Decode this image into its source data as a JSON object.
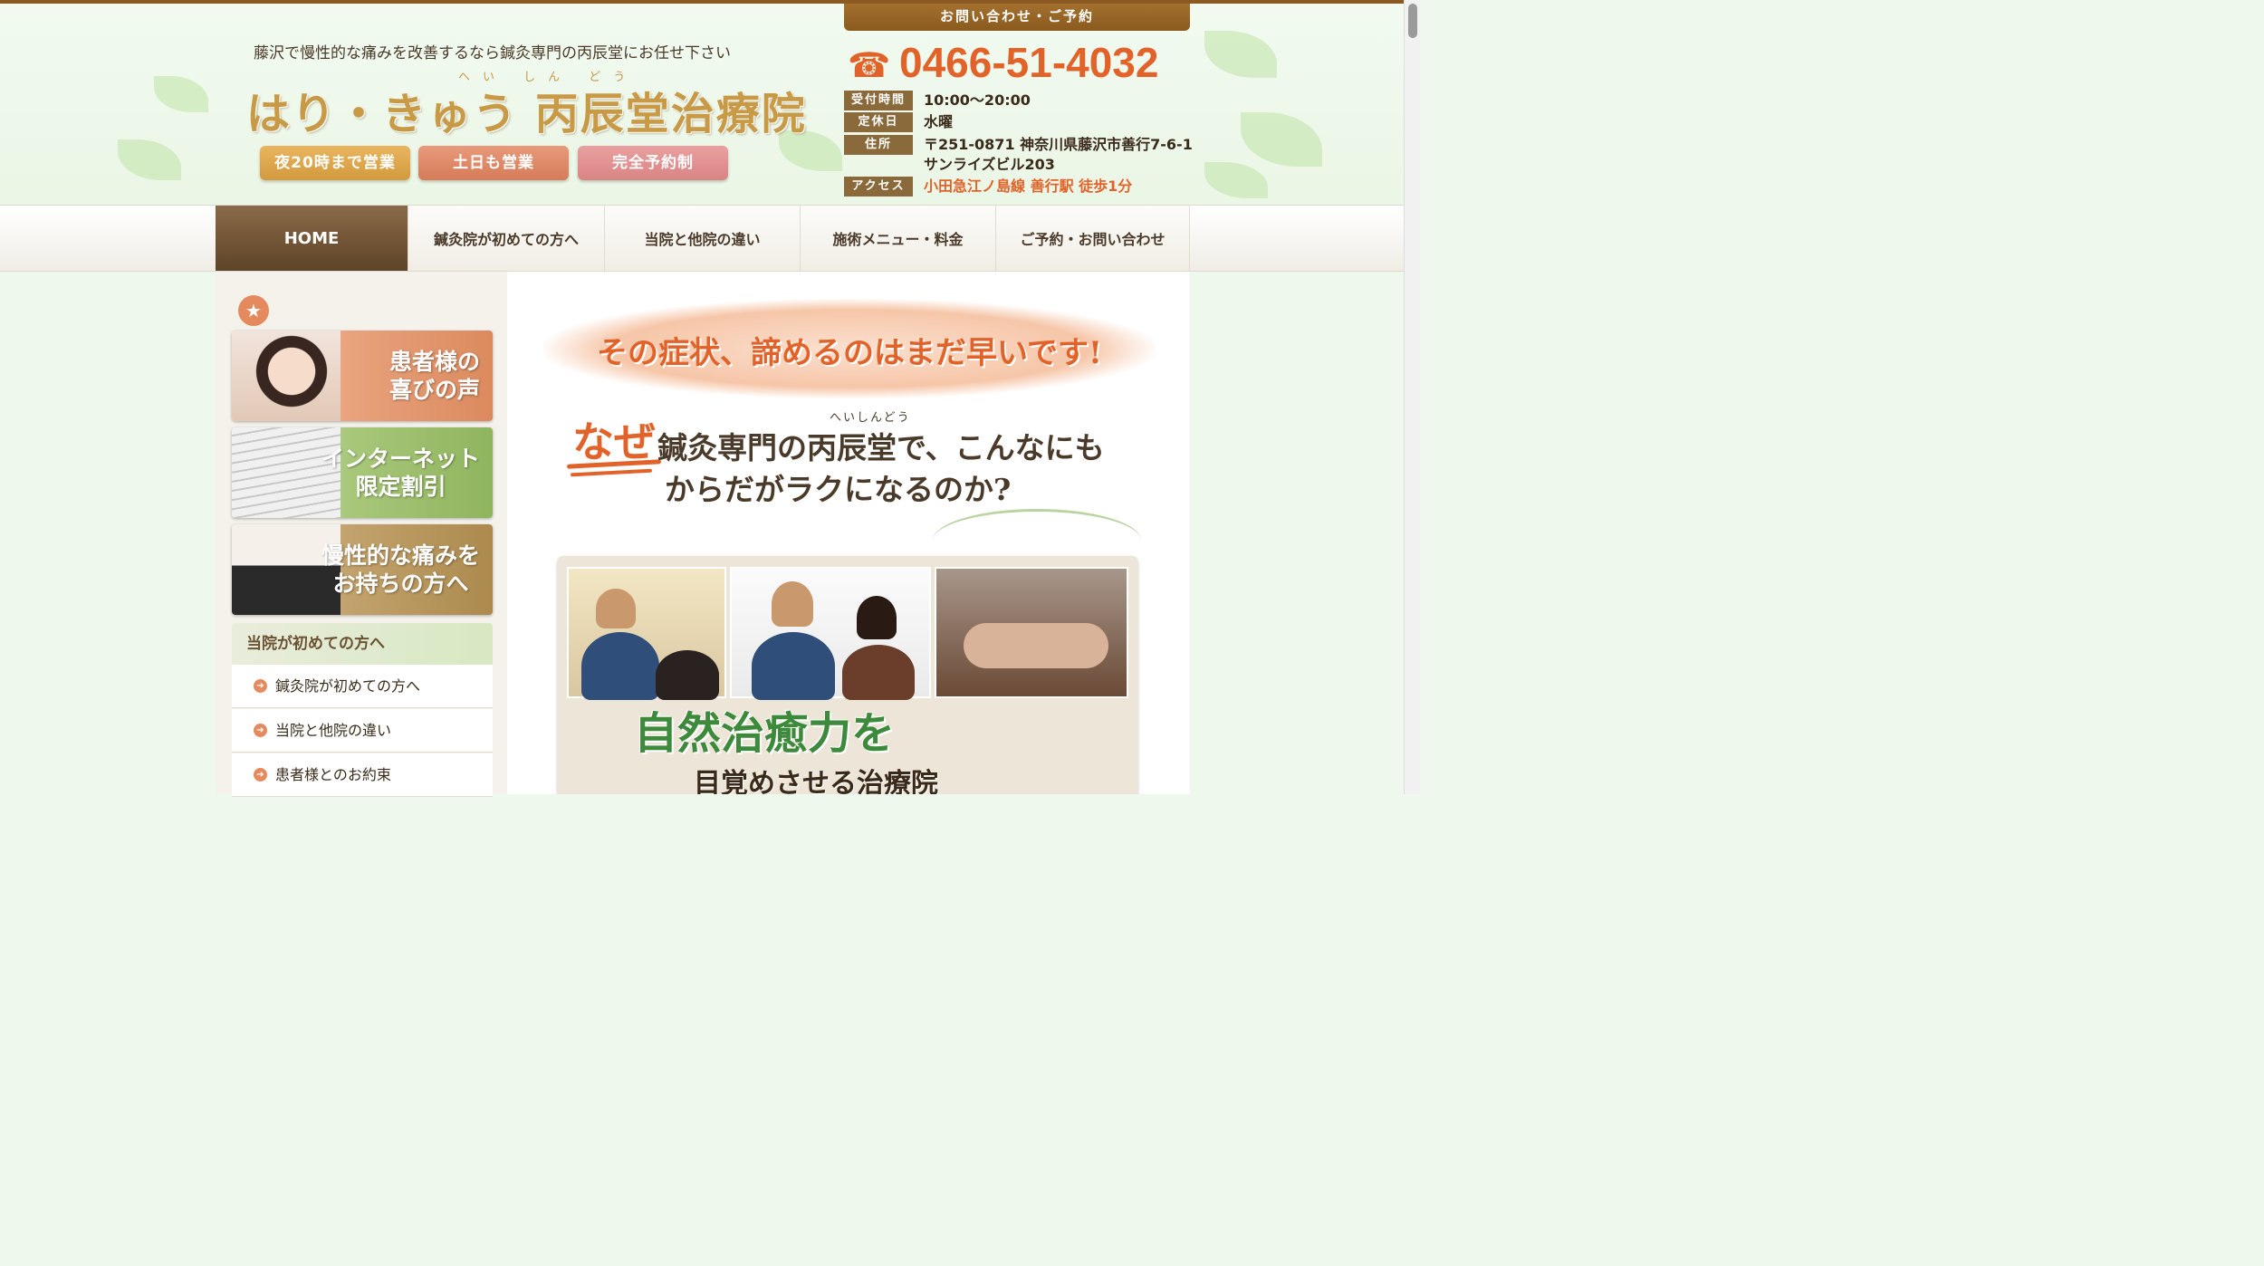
{
  "header": {
    "tagline": "藤沢で慢性的な痛みを改善するなら鍼灸専門の丙辰堂にお任せ下さい",
    "logo_furigana": "へい しん どう",
    "logo": "はり・きゅう 丙辰堂治療院",
    "badges": [
      "夜20時まで営業",
      "土日も営業",
      "完全予約制"
    ]
  },
  "contact": {
    "title": "お問い合わせ・ご予約",
    "phone_icon": "☎",
    "phone": "0466-51-4032",
    "rows": [
      {
        "label": "受付時間",
        "value": "10:00〜20:00"
      },
      {
        "label": "定休日",
        "value": "水曜"
      },
      {
        "label": "住所",
        "value": "〒251-0871 神奈川県藤沢市善行7-6-1"
      },
      {
        "label": "",
        "value": "サンライズビル203"
      },
      {
        "label": "アクセス",
        "value": "小田急江ノ島線 善行駅 徒歩1分"
      }
    ]
  },
  "nav": {
    "items": [
      "HOME",
      "鍼灸院が初めての方へ",
      "当院と他院の違い",
      "施術メニュー・料金",
      "ご予約・お問い合わせ"
    ]
  },
  "sidebar": {
    "star": "★",
    "banners": [
      {
        "line1": "患者様の",
        "line2": "喜びの声"
      },
      {
        "line1": "インターネット",
        "line2": "限定割引"
      },
      {
        "line1": "慢性的な痛みを",
        "line2": "お持ちの方へ"
      }
    ],
    "section_title": "当院が初めての方へ",
    "links": [
      "鍼灸院が初めての方へ",
      "当院と他院の違い",
      "患者様とのお約束"
    ]
  },
  "main": {
    "hero": "その症状、諦めるのはまだ早いです!",
    "why_furigana": "へいしんどう",
    "why_emph": "なぜ",
    "why_line1": "鍼灸専門の丙辰堂で、こんなにも",
    "why_line2": "からだがラクになるのか?",
    "big_title": "自然治癒力を",
    "big_sub": "目覚めさせる治療院"
  },
  "colors": {
    "brand_brown": "#8a5a22",
    "accent_orange": "#e2632a",
    "green": "#3e8a3c"
  }
}
